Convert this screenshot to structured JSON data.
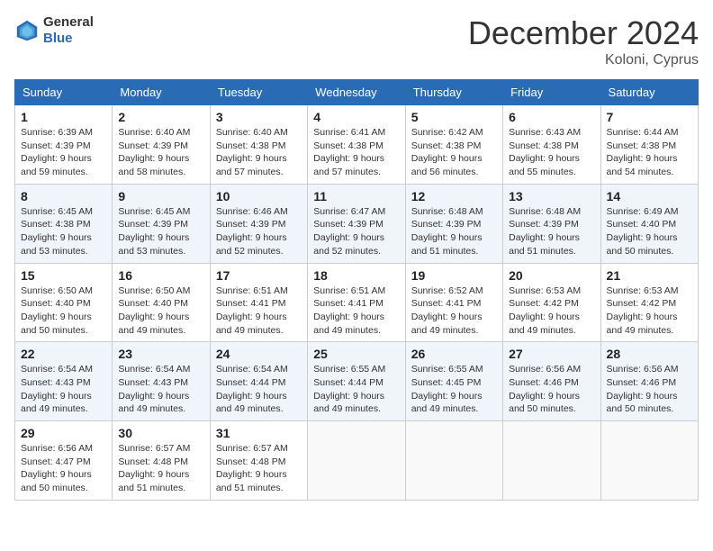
{
  "header": {
    "logo_general": "General",
    "logo_blue": "Blue",
    "title": "December 2024",
    "location": "Koloni, Cyprus"
  },
  "days_of_week": [
    "Sunday",
    "Monday",
    "Tuesday",
    "Wednesday",
    "Thursday",
    "Friday",
    "Saturday"
  ],
  "weeks": [
    [
      {
        "day": 1,
        "sunrise": "6:39 AM",
        "sunset": "4:39 PM",
        "daylight": "9 hours and 59 minutes."
      },
      {
        "day": 2,
        "sunrise": "6:40 AM",
        "sunset": "4:39 PM",
        "daylight": "9 hours and 58 minutes."
      },
      {
        "day": 3,
        "sunrise": "6:40 AM",
        "sunset": "4:38 PM",
        "daylight": "9 hours and 57 minutes."
      },
      {
        "day": 4,
        "sunrise": "6:41 AM",
        "sunset": "4:38 PM",
        "daylight": "9 hours and 57 minutes."
      },
      {
        "day": 5,
        "sunrise": "6:42 AM",
        "sunset": "4:38 PM",
        "daylight": "9 hours and 56 minutes."
      },
      {
        "day": 6,
        "sunrise": "6:43 AM",
        "sunset": "4:38 PM",
        "daylight": "9 hours and 55 minutes."
      },
      {
        "day": 7,
        "sunrise": "6:44 AM",
        "sunset": "4:38 PM",
        "daylight": "9 hours and 54 minutes."
      }
    ],
    [
      {
        "day": 8,
        "sunrise": "6:45 AM",
        "sunset": "4:38 PM",
        "daylight": "9 hours and 53 minutes."
      },
      {
        "day": 9,
        "sunrise": "6:45 AM",
        "sunset": "4:39 PM",
        "daylight": "9 hours and 53 minutes."
      },
      {
        "day": 10,
        "sunrise": "6:46 AM",
        "sunset": "4:39 PM",
        "daylight": "9 hours and 52 minutes."
      },
      {
        "day": 11,
        "sunrise": "6:47 AM",
        "sunset": "4:39 PM",
        "daylight": "9 hours and 52 minutes."
      },
      {
        "day": 12,
        "sunrise": "6:48 AM",
        "sunset": "4:39 PM",
        "daylight": "9 hours and 51 minutes."
      },
      {
        "day": 13,
        "sunrise": "6:48 AM",
        "sunset": "4:39 PM",
        "daylight": "9 hours and 51 minutes."
      },
      {
        "day": 14,
        "sunrise": "6:49 AM",
        "sunset": "4:40 PM",
        "daylight": "9 hours and 50 minutes."
      }
    ],
    [
      {
        "day": 15,
        "sunrise": "6:50 AM",
        "sunset": "4:40 PM",
        "daylight": "9 hours and 50 minutes."
      },
      {
        "day": 16,
        "sunrise": "6:50 AM",
        "sunset": "4:40 PM",
        "daylight": "9 hours and 49 minutes."
      },
      {
        "day": 17,
        "sunrise": "6:51 AM",
        "sunset": "4:41 PM",
        "daylight": "9 hours and 49 minutes."
      },
      {
        "day": 18,
        "sunrise": "6:51 AM",
        "sunset": "4:41 PM",
        "daylight": "9 hours and 49 minutes."
      },
      {
        "day": 19,
        "sunrise": "6:52 AM",
        "sunset": "4:41 PM",
        "daylight": "9 hours and 49 minutes."
      },
      {
        "day": 20,
        "sunrise": "6:53 AM",
        "sunset": "4:42 PM",
        "daylight": "9 hours and 49 minutes."
      },
      {
        "day": 21,
        "sunrise": "6:53 AM",
        "sunset": "4:42 PM",
        "daylight": "9 hours and 49 minutes."
      }
    ],
    [
      {
        "day": 22,
        "sunrise": "6:54 AM",
        "sunset": "4:43 PM",
        "daylight": "9 hours and 49 minutes."
      },
      {
        "day": 23,
        "sunrise": "6:54 AM",
        "sunset": "4:43 PM",
        "daylight": "9 hours and 49 minutes."
      },
      {
        "day": 24,
        "sunrise": "6:54 AM",
        "sunset": "4:44 PM",
        "daylight": "9 hours and 49 minutes."
      },
      {
        "day": 25,
        "sunrise": "6:55 AM",
        "sunset": "4:44 PM",
        "daylight": "9 hours and 49 minutes."
      },
      {
        "day": 26,
        "sunrise": "6:55 AM",
        "sunset": "4:45 PM",
        "daylight": "9 hours and 49 minutes."
      },
      {
        "day": 27,
        "sunrise": "6:56 AM",
        "sunset": "4:46 PM",
        "daylight": "9 hours and 50 minutes."
      },
      {
        "day": 28,
        "sunrise": "6:56 AM",
        "sunset": "4:46 PM",
        "daylight": "9 hours and 50 minutes."
      }
    ],
    [
      {
        "day": 29,
        "sunrise": "6:56 AM",
        "sunset": "4:47 PM",
        "daylight": "9 hours and 50 minutes."
      },
      {
        "day": 30,
        "sunrise": "6:57 AM",
        "sunset": "4:48 PM",
        "daylight": "9 hours and 51 minutes."
      },
      {
        "day": 31,
        "sunrise": "6:57 AM",
        "sunset": "4:48 PM",
        "daylight": "9 hours and 51 minutes."
      },
      null,
      null,
      null,
      null
    ]
  ]
}
